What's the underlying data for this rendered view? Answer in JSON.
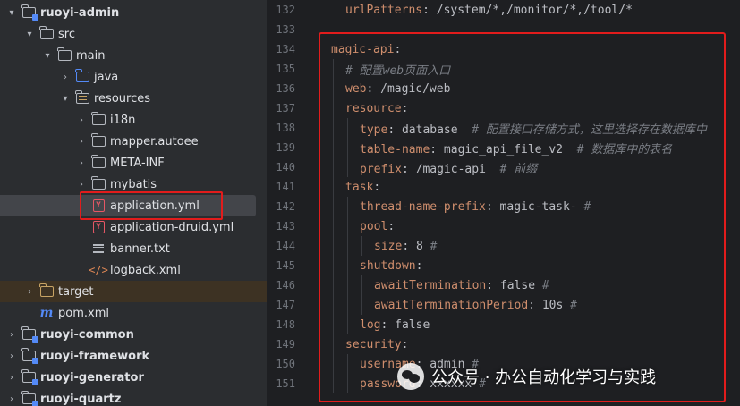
{
  "tree": {
    "items": [
      {
        "label": "ruoyi-admin",
        "chev": "▾",
        "icon": "module"
      },
      {
        "label": "src",
        "chev": "▾",
        "icon": "folder"
      },
      {
        "label": "main",
        "chev": "▾",
        "icon": "folder"
      },
      {
        "label": "java",
        "chev": "›",
        "icon": "folder-blue"
      },
      {
        "label": "resources",
        "chev": "▾",
        "icon": "folder-resources"
      },
      {
        "label": "i18n",
        "chev": "›",
        "icon": "folder"
      },
      {
        "label": "mapper.autoee",
        "chev": "›",
        "icon": "folder"
      },
      {
        "label": "META-INF",
        "chev": "›",
        "icon": "folder"
      },
      {
        "label": "mybatis",
        "chev": "›",
        "icon": "folder"
      },
      {
        "label": "application.yml",
        "chev": "",
        "icon": "yml"
      },
      {
        "label": "application-druid.yml",
        "chev": "",
        "icon": "yml"
      },
      {
        "label": "banner.txt",
        "chev": "",
        "icon": "txt"
      },
      {
        "label": "logback.xml",
        "chev": "",
        "icon": "xml"
      },
      {
        "label": "target",
        "chev": "›",
        "icon": "folder-orange"
      },
      {
        "label": "pom.xml",
        "chev": "",
        "icon": "maven"
      },
      {
        "label": "ruoyi-common",
        "chev": "›",
        "icon": "module"
      },
      {
        "label": "ruoyi-framework",
        "chev": "›",
        "icon": "module"
      },
      {
        "label": "ruoyi-generator",
        "chev": "›",
        "icon": "module"
      },
      {
        "label": "ruoyi-quartz",
        "chev": "›",
        "icon": "module"
      }
    ]
  },
  "editor": {
    "lines": [
      {
        "num": "132",
        "indent": 1,
        "key": "urlPatterns",
        "value": " /system/*,/monitor/*,/tool/*",
        "comment": ""
      },
      {
        "num": "133",
        "indent": 0,
        "key": "",
        "value": "",
        "comment": ""
      },
      {
        "num": "134",
        "indent": 0,
        "key": "magic-api",
        "value": "",
        "comment": ""
      },
      {
        "num": "135",
        "indent": 1,
        "key": "",
        "value": "",
        "comment": "# 配置web页面入口"
      },
      {
        "num": "136",
        "indent": 1,
        "key": "web",
        "value": " /magic/web",
        "comment": ""
      },
      {
        "num": "137",
        "indent": 1,
        "key": "resource",
        "value": "",
        "comment": ""
      },
      {
        "num": "138",
        "indent": 2,
        "key": "type",
        "value": " database  ",
        "comment": "# 配置接口存储方式，这里选择存在数据库中"
      },
      {
        "num": "139",
        "indent": 2,
        "key": "table-name",
        "value": " magic_api_file_v2  ",
        "comment": "# 数据库中的表名"
      },
      {
        "num": "140",
        "indent": 2,
        "key": "prefix",
        "value": " /magic-api  ",
        "comment": "# 前缀"
      },
      {
        "num": "141",
        "indent": 1,
        "key": "task",
        "value": "",
        "comment": ""
      },
      {
        "num": "142",
        "indent": 2,
        "key": "thread-name-prefix",
        "value": " magic-task- ",
        "comment": "#"
      },
      {
        "num": "143",
        "indent": 2,
        "key": "pool",
        "value": "",
        "comment": ""
      },
      {
        "num": "144",
        "indent": 3,
        "key": "size",
        "value": " 8 ",
        "comment": "#"
      },
      {
        "num": "145",
        "indent": 2,
        "key": "shutdown",
        "value": "",
        "comment": ""
      },
      {
        "num": "146",
        "indent": 3,
        "key": "awaitTermination",
        "value": " false ",
        "comment": "#"
      },
      {
        "num": "147",
        "indent": 3,
        "key": "awaitTerminationPeriod",
        "value": " 10s ",
        "comment": "#"
      },
      {
        "num": "148",
        "indent": 2,
        "key": "log",
        "value": " false",
        "comment": ""
      },
      {
        "num": "149",
        "indent": 1,
        "key": "security",
        "value": "",
        "comment": ""
      },
      {
        "num": "150",
        "indent": 2,
        "key": "username",
        "value": " admin ",
        "comment": "#"
      },
      {
        "num": "151",
        "indent": 2,
        "key": "password",
        "value": " xxxxxx ",
        "comment": "#"
      }
    ]
  },
  "watermark": {
    "text": "公众号 · 办公自动化学习与实践"
  },
  "colors": {
    "highlight": "#e21c1c",
    "keyword": "#cf8e6d",
    "comment": "#7a7e85",
    "selection": "#43454a"
  }
}
